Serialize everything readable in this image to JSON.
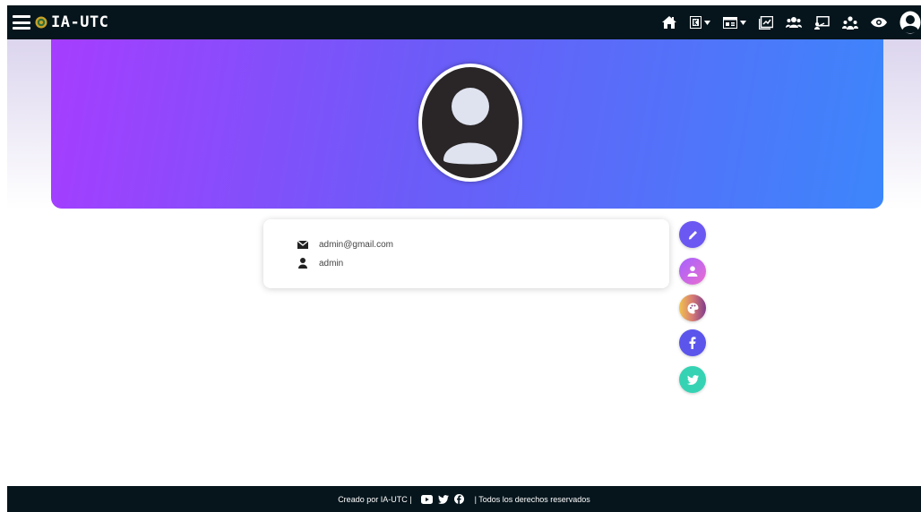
{
  "navbar": {
    "brand": "IA-UTC",
    "icons": [
      "home-icon",
      "k-dropdown-icon",
      "id-card-dropdown-icon",
      "chart-icon",
      "users-icon",
      "presentation-icon",
      "user-group-icon",
      "eye-icon",
      "profile-icon"
    ]
  },
  "profile": {
    "email": "admin@gmail.com",
    "username": "admin"
  },
  "actions": [
    "edit-icon",
    "user-icon",
    "palette-icon",
    "facebook-icon",
    "twitter-icon"
  ],
  "footer": {
    "created_by": "Creado por IA-UTC |",
    "rights": "| Todos los derechos reservados"
  },
  "colors": {
    "navbar": "#06151c",
    "hero_start": "#a63dff",
    "hero_end": "#3c86fb",
    "edit": "#6b58f2",
    "facebook": "#5b55ec",
    "twitter": "#35d3b4"
  }
}
